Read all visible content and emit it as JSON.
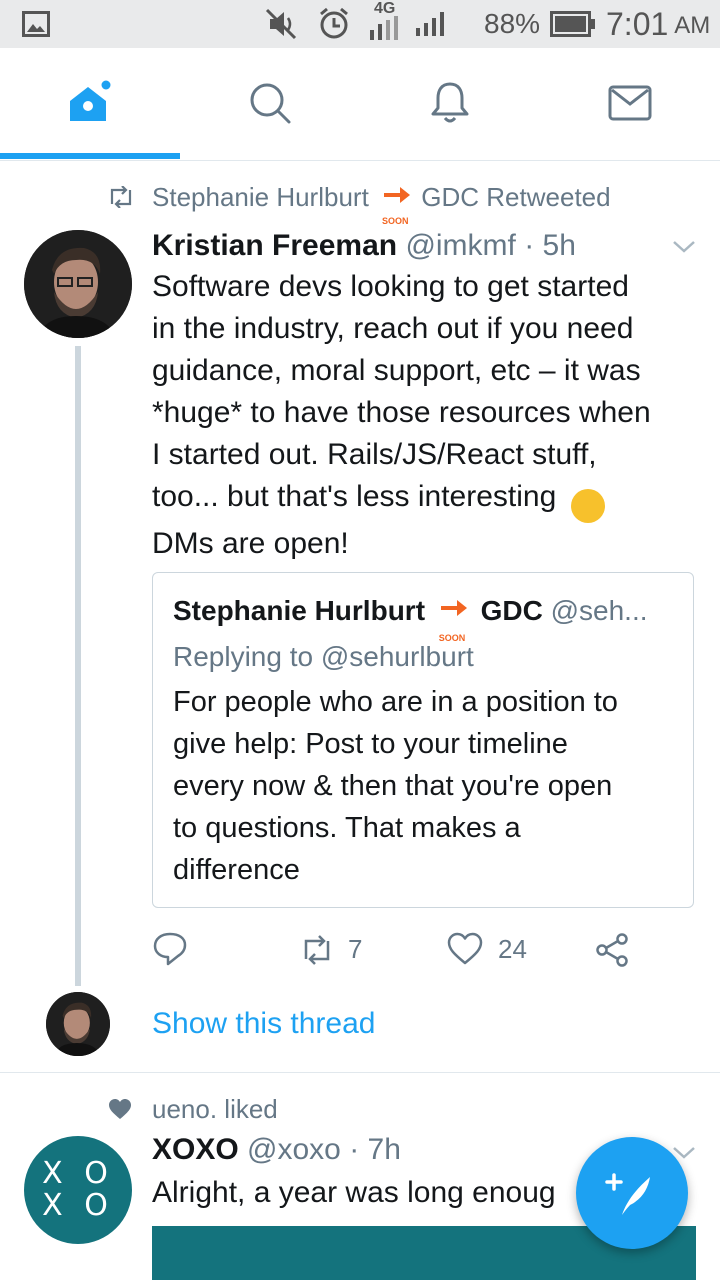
{
  "status_bar": {
    "network_label": "4G",
    "battery": "88%",
    "time": "7:01",
    "ampm": "AM"
  },
  "tabs": [
    {
      "name": "home",
      "active": true
    },
    {
      "name": "search",
      "active": false
    },
    {
      "name": "notifications",
      "active": false
    },
    {
      "name": "messages",
      "active": false
    }
  ],
  "tweet1": {
    "retweet_by": "Stephanie Hurlburt",
    "retweet_suffix": "GDC Retweeted",
    "soon_badge": "SOON",
    "author_name": "Kristian Freeman",
    "author_handle": "@imkmf",
    "time": "· 5h",
    "text_lines": [
      "Software devs looking to get started",
      "in the industry, reach out if you need",
      "guidance, moral support, etc – it was",
      "*huge* to have those resources when",
      "I started out. Rails/JS/React stuff,",
      "too... but that's less interesting",
      "DMs are open!"
    ],
    "emoji": "😊",
    "quote": {
      "author_name": "Stephanie Hurlburt",
      "author_suffix": "GDC",
      "author_handle": "@seh...",
      "soon_badge": "SOON",
      "replying_to": "Replying to @sehurlburt",
      "text_lines": [
        "For people who are in a position to",
        "give help: Post to your timeline",
        "every now & then that you're open",
        "to questions. That makes a",
        "difference"
      ]
    },
    "retweet_count": "7",
    "like_count": "24",
    "show_thread": "Show this thread"
  },
  "tweet2": {
    "liked_by": "ueno. liked",
    "author_name": "XOXO",
    "author_handle": "@xoxo",
    "time": "· 7h",
    "text": "Alright, a year was long enoug",
    "avatar_text_top": "X O",
    "avatar_text_bottom": "X O"
  },
  "colors": {
    "accent": "#1da1f2",
    "retweet_green": "#17bf63",
    "grey_text": "#657786",
    "xoxo_teal": "#14737d"
  }
}
